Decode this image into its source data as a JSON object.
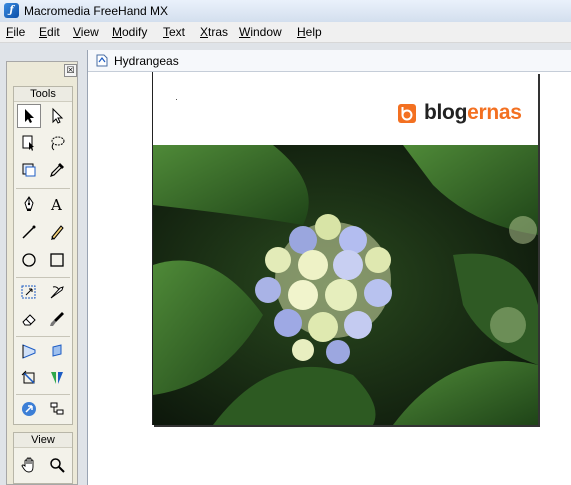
{
  "app": {
    "title": "Macromedia FreeHand MX"
  },
  "menu": [
    {
      "pre": "",
      "u": "F",
      "post": "ile"
    },
    {
      "pre": "",
      "u": "E",
      "post": "dit"
    },
    {
      "pre": "",
      "u": "V",
      "post": "iew"
    },
    {
      "pre": "",
      "u": "M",
      "post": "odify"
    },
    {
      "pre": "",
      "u": "T",
      "post": "ext"
    },
    {
      "pre": "",
      "u": "X",
      "post": "tras"
    },
    {
      "pre": "",
      "u": "W",
      "post": "indow"
    },
    {
      "pre": "",
      "u": "H",
      "post": "elp"
    }
  ],
  "toolbox": {
    "tools_label": "Tools",
    "view_label": "View",
    "close_glyph": "☒"
  },
  "document": {
    "title": "Hydrangeas"
  },
  "logo": {
    "text_a": "blog",
    "text_b": "ernas"
  },
  "colors": {
    "brand_orange": "#f37021",
    "window_bg": "#dfe3e8"
  }
}
